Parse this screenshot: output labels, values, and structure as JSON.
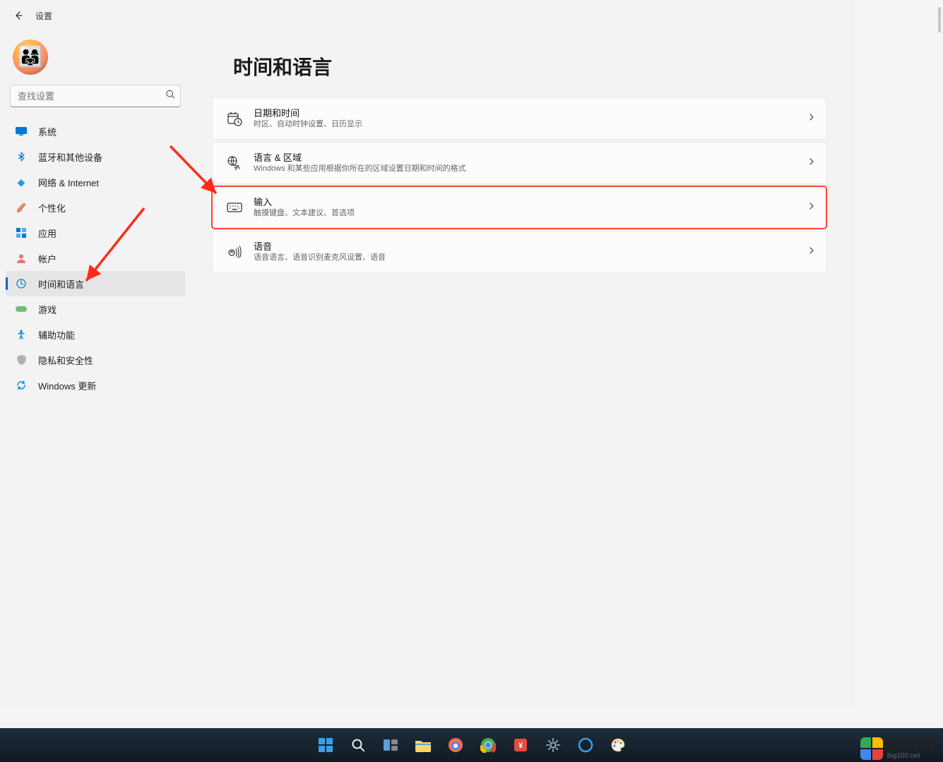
{
  "titlebar": {
    "title": "设置"
  },
  "search": {
    "placeholder": "查找设置"
  },
  "sidebar": {
    "items": [
      {
        "label": "系统"
      },
      {
        "label": "蓝牙和其他设备"
      },
      {
        "label": "网络 & Internet"
      },
      {
        "label": "个性化"
      },
      {
        "label": "应用"
      },
      {
        "label": "帐户"
      },
      {
        "label": "时间和语言"
      },
      {
        "label": "游戏"
      },
      {
        "label": "辅助功能"
      },
      {
        "label": "隐私和安全性"
      },
      {
        "label": "Windows 更新"
      }
    ]
  },
  "page": {
    "title": "时间和语言"
  },
  "cards": [
    {
      "title": "日期和时间",
      "desc": "时区、自动时钟设置、日历显示"
    },
    {
      "title": "语言 & 区域",
      "desc": "Windows 和某些应用根据你所在的区域设置日期和时间的格式"
    },
    {
      "title": "输入",
      "desc": "触摸键盘、文本建议、首选项"
    },
    {
      "title": "语音",
      "desc": "语音语言、语音识别麦克风设置、语音"
    }
  ],
  "watermark": {
    "cn": "大百网",
    "en": "big100.net"
  }
}
